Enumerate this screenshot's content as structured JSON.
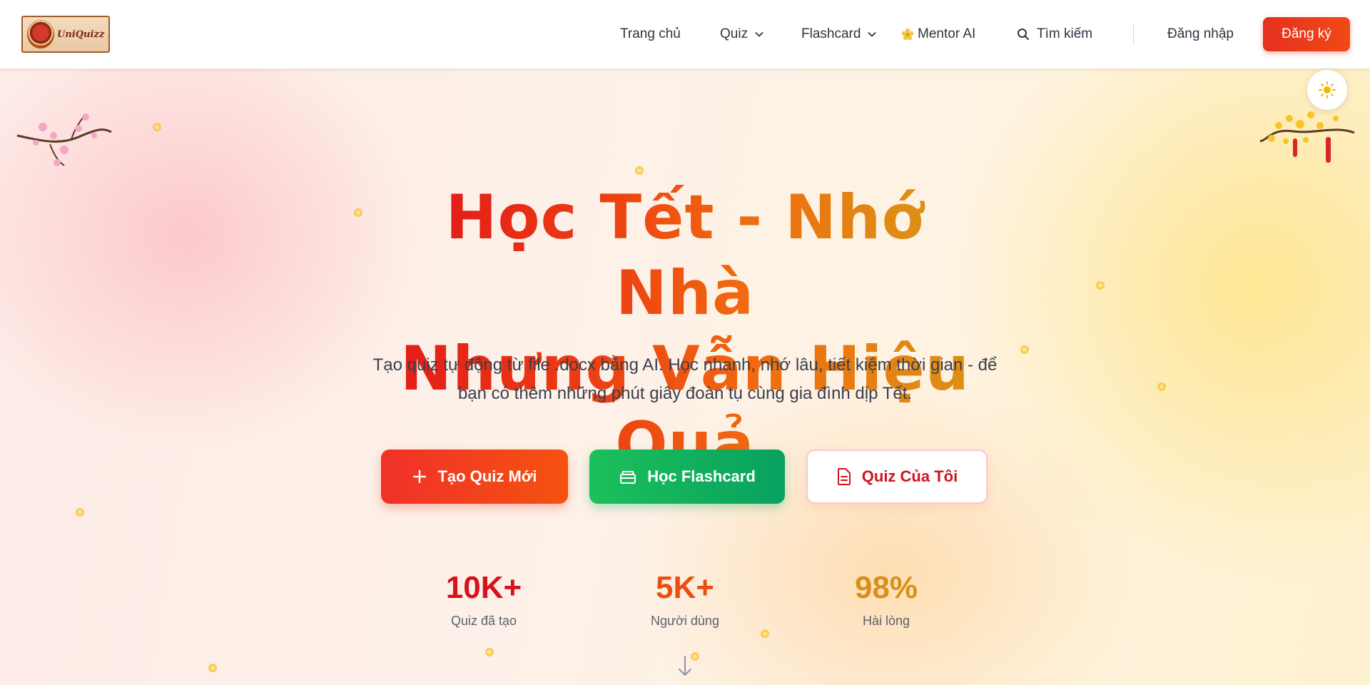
{
  "header": {
    "logo_text": "UniQuizz",
    "nav": {
      "home": "Trang chủ",
      "quiz": "Quiz",
      "flashcard": "Flashcard",
      "mentor": "Mentor AI",
      "search": "Tìm kiếm",
      "login": "Đăng nhập",
      "signup": "Đăng ký"
    }
  },
  "hero": {
    "title_line1": "Học Tết - Nhớ Nhà",
    "title_line2": "Nhưng Vẫn Hiệu Quả",
    "subtitle_line1": "Tạo quiz tự động từ file .docx bằng AI. Học nhanh, nhớ lâu, tiết kiệm thời gian - để",
    "subtitle_line2": "bạn có thêm những phút giây đoàn tụ cùng gia đình dịp Tết."
  },
  "actions": {
    "create_quiz": "Tạo Quiz Mới",
    "study_flashcard": "Học Flashcard",
    "my_quiz": "Quiz Của Tôi"
  },
  "stats": [
    {
      "value": "10K+",
      "label": "Quiz đã tạo",
      "color": "#d8121c"
    },
    {
      "value": "5K+",
      "label": "Người dùng",
      "color": "#ec4d12"
    },
    {
      "value": "98%",
      "label": "Hài lòng",
      "color": "#d9901a"
    }
  ],
  "icons": {
    "quiz_chevron": "chevron-down-icon",
    "flashcard_chevron": "chevron-down-icon",
    "mentor": "sparkle-flower-icon",
    "search": "search-icon",
    "theme": "sun-icon",
    "create": "plus-icon",
    "flashcard": "cards-stack-icon",
    "my_quiz": "document-icon",
    "scroll": "arrow-down-icon"
  },
  "colors": {
    "primary_red": "#e5301f",
    "green": "#12b05c",
    "accent_gold": "#d9951a"
  }
}
